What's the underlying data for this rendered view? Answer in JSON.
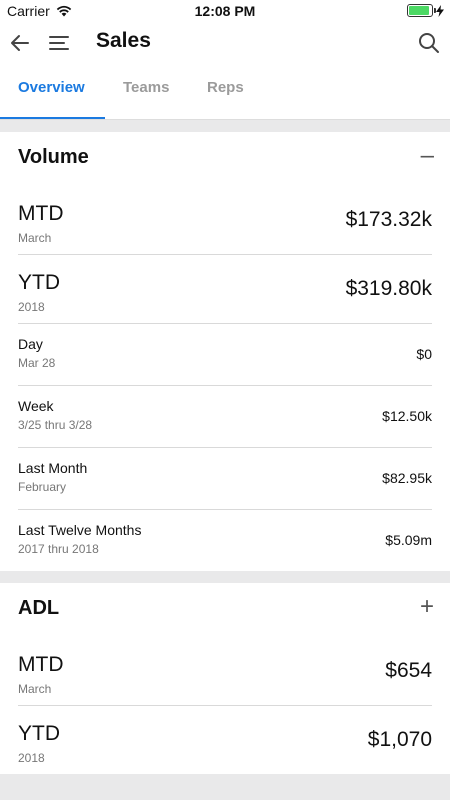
{
  "status": {
    "carrier": "Carrier",
    "time": "12:08 PM"
  },
  "nav": {
    "title": "Sales",
    "back_icon": "back-arrow-icon",
    "menu_icon": "hamburger-menu-icon",
    "search_icon": "search-icon"
  },
  "tabs": [
    {
      "label": "Overview",
      "active": true
    },
    {
      "label": "Teams",
      "active": false
    },
    {
      "label": "Reps",
      "active": false
    }
  ],
  "volume": {
    "title": "Volume",
    "toggle": "–",
    "rows": [
      {
        "label": "MTD",
        "sub": "March",
        "value": "$173.32k"
      },
      {
        "label": "YTD",
        "sub": "2018",
        "value": "$319.80k"
      },
      {
        "label": "Day",
        "sub": "Mar 28",
        "value": "$0"
      },
      {
        "label": "Week",
        "sub": "3/25 thru 3/28",
        "value": "$12.50k"
      },
      {
        "label": "Last Month",
        "sub": "February",
        "value": "$82.95k"
      },
      {
        "label": "Last Twelve Months",
        "sub": "2017 thru 2018",
        "value": "$5.09m"
      }
    ]
  },
  "adl": {
    "title": "ADL",
    "toggle": "+",
    "rows": [
      {
        "label": "MTD",
        "sub": "March",
        "value": "$654"
      },
      {
        "label": "YTD",
        "sub": "2018",
        "value": "$1,070"
      }
    ]
  },
  "colors": {
    "accent": "#1b7ae0",
    "battery": "#4cd964"
  }
}
